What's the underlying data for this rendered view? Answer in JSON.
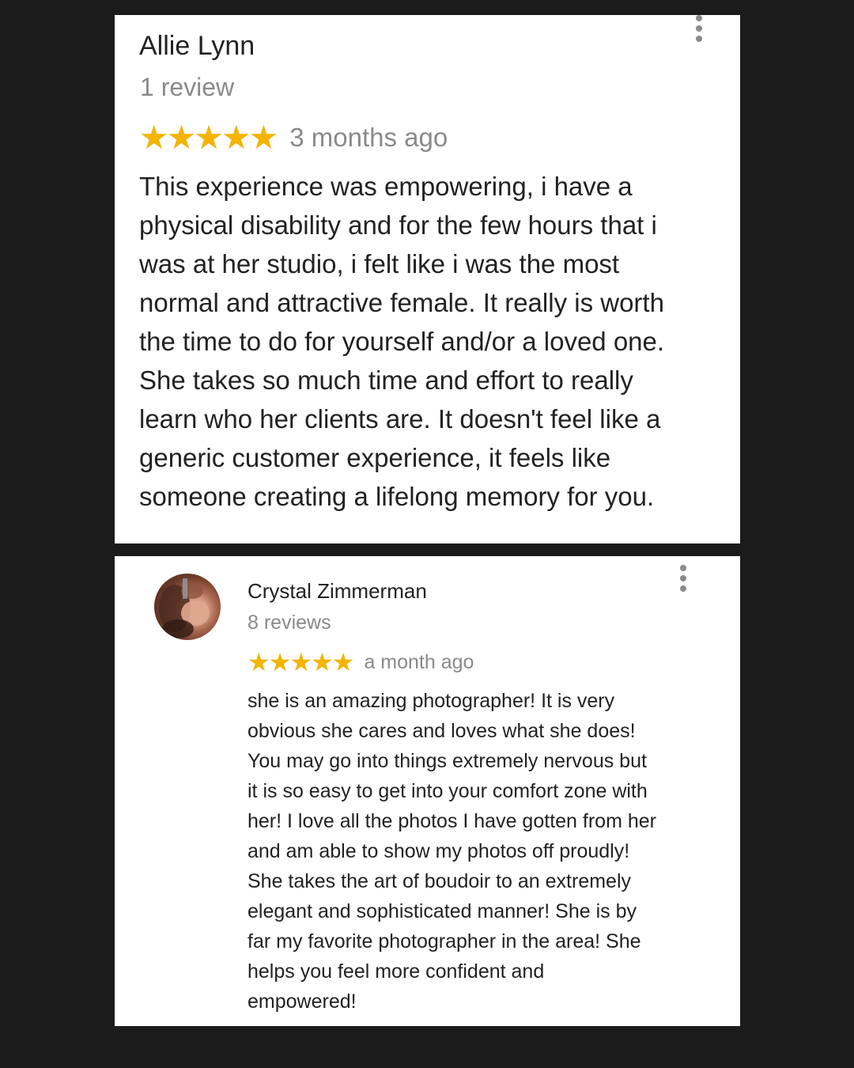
{
  "colors": {
    "background": "#1b1b1b",
    "card": "#ffffff",
    "star": "#f4b400",
    "muted_text": "#8a8a8a",
    "text": "#222222"
  },
  "reviews": [
    {
      "author": "Allie Lynn",
      "review_count": "1 review",
      "stars": "★★★★★",
      "rating": 5,
      "time_ago": "3 months ago",
      "text_lines": [
        "This experience was empowering, i have a",
        "physical disability and for the few hours that i",
        "was at her studio, i felt like i was the most",
        "normal and attractive female. It really is worth",
        "the time to do for yourself and/or a loved one.",
        "She takes so much time and effort to really",
        "learn who her clients are. It doesn't feel like a",
        "generic customer experience, it feels like",
        "someone creating a lifelong memory for you."
      ],
      "menu_icon": "more-vert-icon"
    },
    {
      "author": "Crystal Zimmerman",
      "review_count": "8 reviews",
      "stars": "★★★★★",
      "rating": 5,
      "time_ago": "a month ago",
      "text_lines": [
        "she is an amazing photographer! It is very",
        "obvious she cares and loves what she does!",
        "You may go into things extremely nervous but",
        "it is so easy to get into your comfort zone with",
        "her! I love all the photos I have gotten from her",
        "and am able to show my photos off proudly!",
        "She takes the art of boudoir to an extremely",
        "elegant and sophisticated manner! She is by",
        "far my favorite photographer in the area!  She",
        "helps you feel more confident and",
        "empowered!"
      ],
      "menu_icon": "more-vert-icon",
      "avatar_icon": "user-avatar"
    }
  ]
}
